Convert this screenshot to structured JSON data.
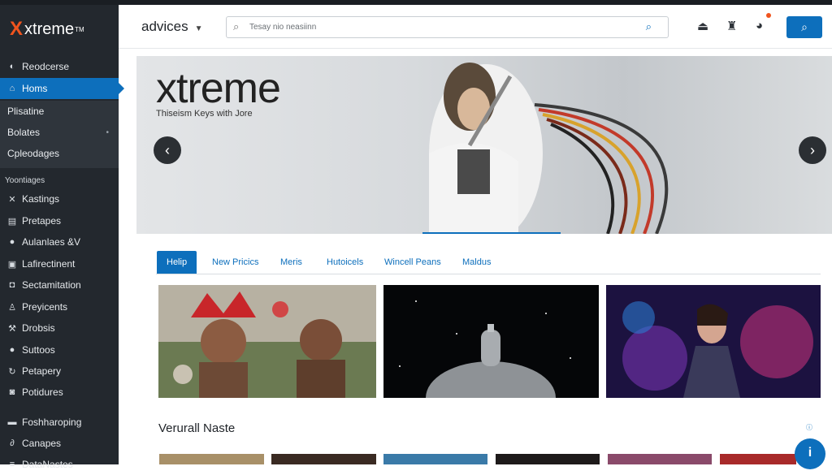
{
  "app": {
    "brand_name": "xtreme",
    "brand_mark": "X",
    "brand_tm": "TM"
  },
  "sidebar": {
    "items": [
      {
        "label": "Reodcerse",
        "icon": "gauge-icon"
      },
      {
        "label": "Homs",
        "icon": "home-icon",
        "active": true
      }
    ],
    "sub_items": [
      {
        "label": "Plisatine"
      },
      {
        "label": "Bolates"
      },
      {
        "label": "Cpleodages"
      }
    ],
    "section_label": "Yoontiages",
    "nav": [
      {
        "label": "Kastings",
        "icon": "tools-icon"
      },
      {
        "label": "Pretapes",
        "icon": "grid-icon"
      },
      {
        "label": "Aulanlaes &V",
        "icon": "users-icon"
      },
      {
        "label": "Lafirectinent",
        "icon": "window-icon"
      },
      {
        "label": "Sectamitation",
        "icon": "shield-icon"
      },
      {
        "label": "Preyicents",
        "icon": "person-icon"
      },
      {
        "label": "Drobsis",
        "icon": "wrench-icon"
      },
      {
        "label": "Suttoos",
        "icon": "user-icon"
      },
      {
        "label": "Petapery",
        "icon": "refresh-icon"
      },
      {
        "label": "Potidures",
        "icon": "lock-icon"
      },
      {
        "label": "Foshharoping",
        "icon": "folder-icon"
      },
      {
        "label": "Canapes",
        "icon": "link-icon"
      },
      {
        "label": "DataNastes",
        "icon": "list-icon"
      }
    ]
  },
  "header": {
    "title": "advices",
    "search_placeholder": "Tesay nio neasiinn",
    "icons": [
      "upload-icon",
      "robot-icon",
      "notifications-icon"
    ],
    "search_button_icon": "search-icon"
  },
  "hero": {
    "title": "xtreme",
    "subtitle": "Thiseism Keys with Jore"
  },
  "tabs": [
    {
      "label": "Helip",
      "active": true
    },
    {
      "label": "New Pricics"
    },
    {
      "label": "Meris"
    },
    {
      "label": "Hutoicels"
    },
    {
      "label": "Wincell Peans"
    },
    {
      "label": "Maldus"
    }
  ],
  "section": {
    "title": "Verurall Naste"
  },
  "colors": {
    "accent": "#0d6fbc",
    "sidebar": "#23282e",
    "brand": "#f0541e"
  }
}
